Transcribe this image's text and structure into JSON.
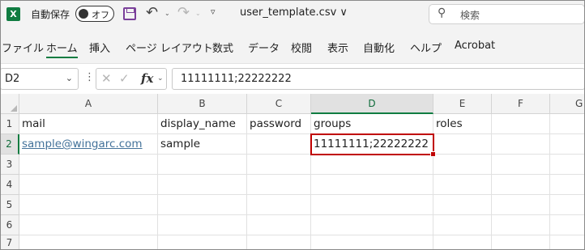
{
  "titlebar": {
    "app_icon": "excel-icon",
    "app_icon_letter": "X",
    "autosave_label": "自動保存",
    "autosave_state": "オフ",
    "save_icon": "save-icon",
    "undo_icon": "undo-icon",
    "redo_icon": "redo-icon",
    "qat_more_icon": "customize-qat-icon",
    "filename": "user_template.csv ∨",
    "search_placeholder": "検索"
  },
  "ribbon": {
    "tabs": [
      {
        "label": "ファイル"
      },
      {
        "label": "ホーム",
        "active": true
      },
      {
        "label": "挿入"
      },
      {
        "label": "ページ レイアウト"
      },
      {
        "label": "数式"
      },
      {
        "label": "データ"
      },
      {
        "label": "校閲"
      },
      {
        "label": "表示"
      },
      {
        "label": "自動化"
      },
      {
        "label": "ヘルプ"
      },
      {
        "label": "Acrobat"
      }
    ]
  },
  "formula_bar": {
    "name_box": "D2",
    "formula": "11111111;22222222"
  },
  "sheet": {
    "columns": [
      "A",
      "B",
      "C",
      "D",
      "E",
      "F",
      "G"
    ],
    "selected_column": "D",
    "rows": [
      "1",
      "2",
      "3",
      "4",
      "5",
      "6",
      "7"
    ],
    "selected_row": "2",
    "cells": {
      "A1": "mail",
      "B1": "display_name",
      "C1": "password",
      "D1": "groups",
      "E1": "roles",
      "A2": "sample@wingarc.com",
      "B2": "sample",
      "D2": "11111111;22222222"
    },
    "active_cell": "D2"
  },
  "colors": {
    "excel_green": "#107c41",
    "active_cell_border": "#c00000",
    "link": "#43729a"
  }
}
